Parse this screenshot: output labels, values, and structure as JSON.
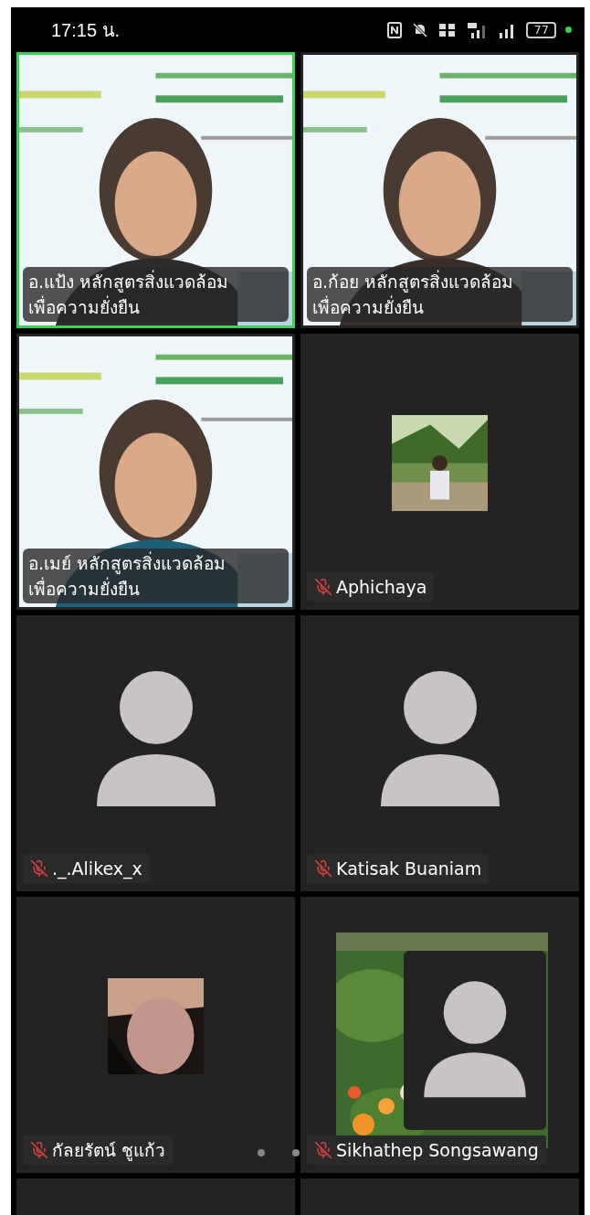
{
  "status_bar": {
    "time": "17:15 น.",
    "battery": "77"
  },
  "tiles": [
    {
      "kind": "video",
      "name": "อ.แป้ง หลักสูตรสิ่งแวดล้อม\nเพื่อความยั่งยืน",
      "selected": true
    },
    {
      "kind": "video",
      "name": "อ.ก้อย หลักสูตรสิ่งแวดล้อม\nเพื่อความยั่งยืน",
      "selected": false
    },
    {
      "kind": "video",
      "name": "อ.เมย์ หลักสูตรสิ่งแวดล้อม\nเพื่อความยั่งยืน",
      "selected": false
    },
    {
      "name": "Aphichaya",
      "selected": false,
      "muted": true
    },
    {
      "kind": "avatar",
      "name": "._.Alikex_x",
      "selected": false,
      "muted": true
    },
    {
      "kind": "avatar",
      "name": "Katisak Buaniam",
      "selected": false,
      "muted": true
    },
    {
      "name": "กัลยรัตน์ ชูแก้ว",
      "selected": false,
      "muted": true
    },
    {
      "kind": "garden",
      "name": "Sikhathep Songsawang",
      "selected": false,
      "muted": true
    }
  ]
}
